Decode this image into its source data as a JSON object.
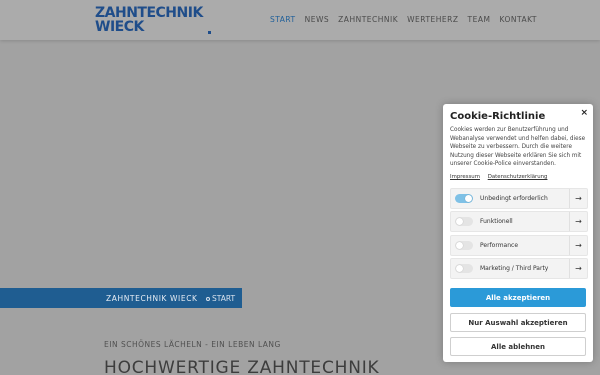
{
  "header": {
    "logo_line1": "ZAHNTECHNIK",
    "logo_line2": "WIECK",
    "nav": [
      "START",
      "NEWS",
      "ZAHNTECHNIK",
      "WERTEHERZ",
      "TEAM",
      "KONTAKT"
    ],
    "active_nav": "START"
  },
  "band": {
    "title": "ZAHNTECHNIK WIECK",
    "breadcrumb": "START"
  },
  "main": {
    "tagline": "EIN SCHÖNES LÄCHELN - EIN LEBEN LANG",
    "headline": "HOCHWERTIGE ZAHNTECHNIK"
  },
  "cookie": {
    "title": "Cookie-Richtlinie",
    "close": "×",
    "text": "Cookies werden zur Benutzerführung und Webanalyse verwendet und helfen dabei, diese Webseite zu verbessern. Durch die weitere Nutzung dieser Webseite erklären Sie sich mit unserer Cookie-Police einverstanden.",
    "links": [
      "Impressum",
      "Datenschutzerklärung"
    ],
    "categories": [
      {
        "label": "Unbedingt erforderlich",
        "enabled": true
      },
      {
        "label": "Funktionell",
        "enabled": false
      },
      {
        "label": "Performance",
        "enabled": false
      },
      {
        "label": "Marketing / Third Party",
        "enabled": false
      }
    ],
    "accept_all": "Alle akzeptieren",
    "accept_selection": "Nur Auswahl akzeptieren",
    "reject_all": "Alle ablehnen"
  },
  "colors": {
    "brand_blue": "#1f5d91",
    "accept_blue": "#2b9ad8",
    "toggle_on": "#7fc1e6"
  }
}
